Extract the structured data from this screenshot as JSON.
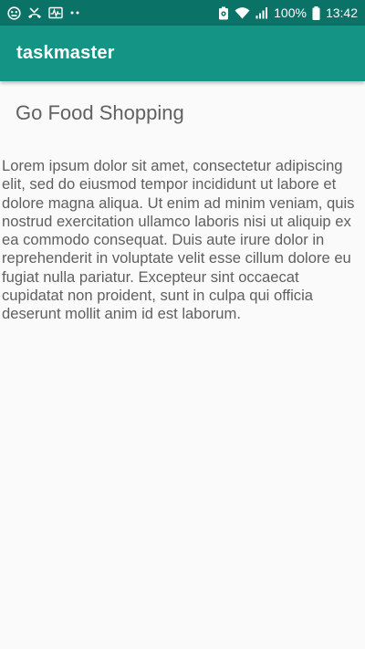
{
  "status_bar": {
    "icons": [
      "face-icon",
      "missed-call-icon",
      "activity-icon",
      "more-dots-icon",
      "battery-saver-icon",
      "wifi-icon",
      "signal-icon",
      "battery-icon"
    ],
    "battery": "100%",
    "time": "13:42"
  },
  "app_bar": {
    "title": "taskmaster",
    "color": "#139484",
    "status_color": "#0b7267"
  },
  "task": {
    "title": "Go Food Shopping",
    "body": "Lorem ipsum dolor sit amet, consectetur adipiscing elit, sed do eiusmod tempor incididunt ut labore et dolore magna aliqua. Ut enim ad minim veniam, quis nostrud exercitation ullamco laboris nisi ut aliquip ex ea commodo consequat. Duis aute irure dolor in reprehenderit in voluptate velit esse cillum dolore eu fugiat nulla pariatur. Excepteur sint occaecat cupidatat non proident, sunt in culpa qui officia deserunt mollit anim id est laborum."
  }
}
